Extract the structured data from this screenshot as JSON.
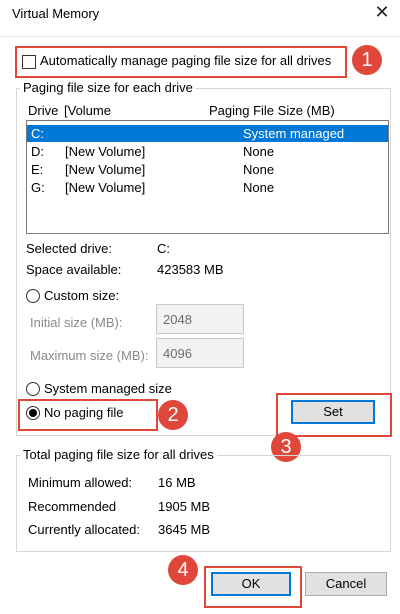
{
  "window": {
    "title": "Virtual Memory",
    "close_glyph": "✕"
  },
  "auto_manage": {
    "label": "Automatically manage paging file size for all drives",
    "checked": false
  },
  "paging_group": {
    "title": "Paging file size for each drive",
    "headers": {
      "drive": "Drive",
      "volume": "[Volume",
      "size": "Paging File Size (MB)"
    },
    "rows": [
      {
        "drive": "C:",
        "volume": "",
        "size": "System managed",
        "selected": true
      },
      {
        "drive": "D:",
        "volume": "[New Volume]",
        "size": "None",
        "selected": false
      },
      {
        "drive": "E:",
        "volume": "[New Volume]",
        "size": "None",
        "selected": false
      },
      {
        "drive": "G:",
        "volume": "[New Volume]",
        "size": "None",
        "selected": false
      }
    ],
    "selected_drive_label": "Selected drive:",
    "selected_drive_value": "C:",
    "space_available_label": "Space available:",
    "space_available_value": "423583 MB",
    "custom_size_label": "Custom size:",
    "initial_size_label": "Initial size (MB):",
    "initial_size_value": "2048",
    "maximum_size_label": "Maximum size (MB):",
    "maximum_size_value": "4096",
    "system_managed_label": "System managed size",
    "no_paging_label": "No paging file",
    "selected_option": "no_paging",
    "set_button": "Set"
  },
  "total_group": {
    "title": "Total paging file size for all drives",
    "minimum_label": "Minimum allowed:",
    "minimum_value": "16 MB",
    "recommended_label": "Recommended",
    "recommended_value": "1905 MB",
    "allocated_label": "Currently allocated:",
    "allocated_value": "3645 MB"
  },
  "buttons": {
    "ok": "OK",
    "cancel": "Cancel"
  },
  "callouts": {
    "one": "1",
    "two": "2",
    "three": "3",
    "four": "4"
  },
  "colors": {
    "accent": "#0078d7",
    "callout_red": "#e0473b"
  }
}
